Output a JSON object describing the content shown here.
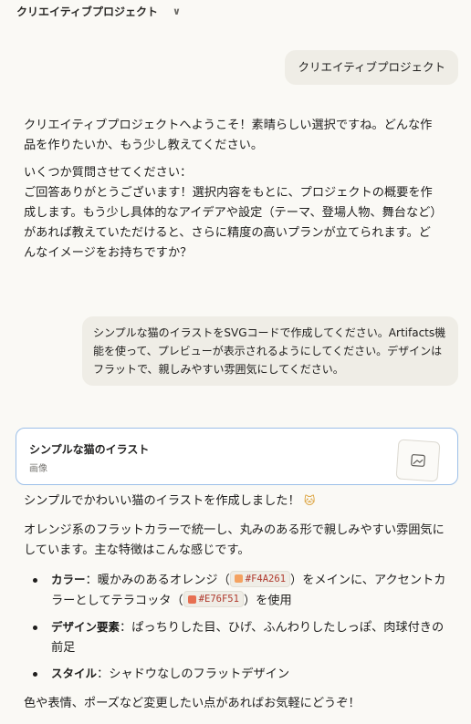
{
  "header": {
    "title": "クリエイティブプロジェクト",
    "chevron": "∨"
  },
  "messages": {
    "user1": "クリエイティブプロジェクト",
    "ai1": {
      "p1": "クリエイティブプロジェクトへようこそ！素晴らしい選択ですね。どんな作品を作りたいか、もう少し教えてください。",
      "p2_line1": "いくつか質問させてください：",
      "p2_line2": "ご回答ありがとうございます！選択内容をもとに、プロジェクトの概要を作成します。もう少し具体的なアイデアや設定（テーマ、登場人物、舞台など）があれば教えていただけると、さらに精度の高いプランが立てられます。どんなイメージをお持ちですか？"
    },
    "user2": "シンプルな猫のイラストをSVGコードで作成してください。Artifacts機能を使って、プレビューが表示されるようにしてください。デザインはフラットで、親しみやすい雰囲気にしてください。",
    "artifact": {
      "title": "シンプルな猫のイラスト",
      "subtitle": "画像",
      "icon": "image-icon"
    },
    "ai2": {
      "p1": "シンプルでかわいい猫のイラストを作成しました！",
      "emoji": "🐱",
      "p2": "オレンジ系のフラットカラーで統一し、丸みのある形で親しみやすい雰囲気にしています。主な特徴はこんな感じです。",
      "features": [
        {
          "label": "カラー",
          "pre": "：暖かみのあるオレンジ（",
          "code1": "#F4A261",
          "mid": "）をメインに、アクセントカラーとしてテラコッタ（",
          "code2": "#E76F51",
          "post": "）を使用"
        },
        {
          "label": "デザイン要素",
          "text": "：ぱっちりした目、ひげ、ふんわりしたしっぽ、肉球付きの前足"
        },
        {
          "label": "スタイル",
          "text": "：シャドウなしのフラットデザイン"
        }
      ],
      "p3": "色や表情、ポーズなど変更したい点があればお気軽にどうぞ！"
    }
  },
  "colors": {
    "swatch1": "#F4A261",
    "swatch2": "#E76F51",
    "artifact_border": "#9cbfe8"
  }
}
